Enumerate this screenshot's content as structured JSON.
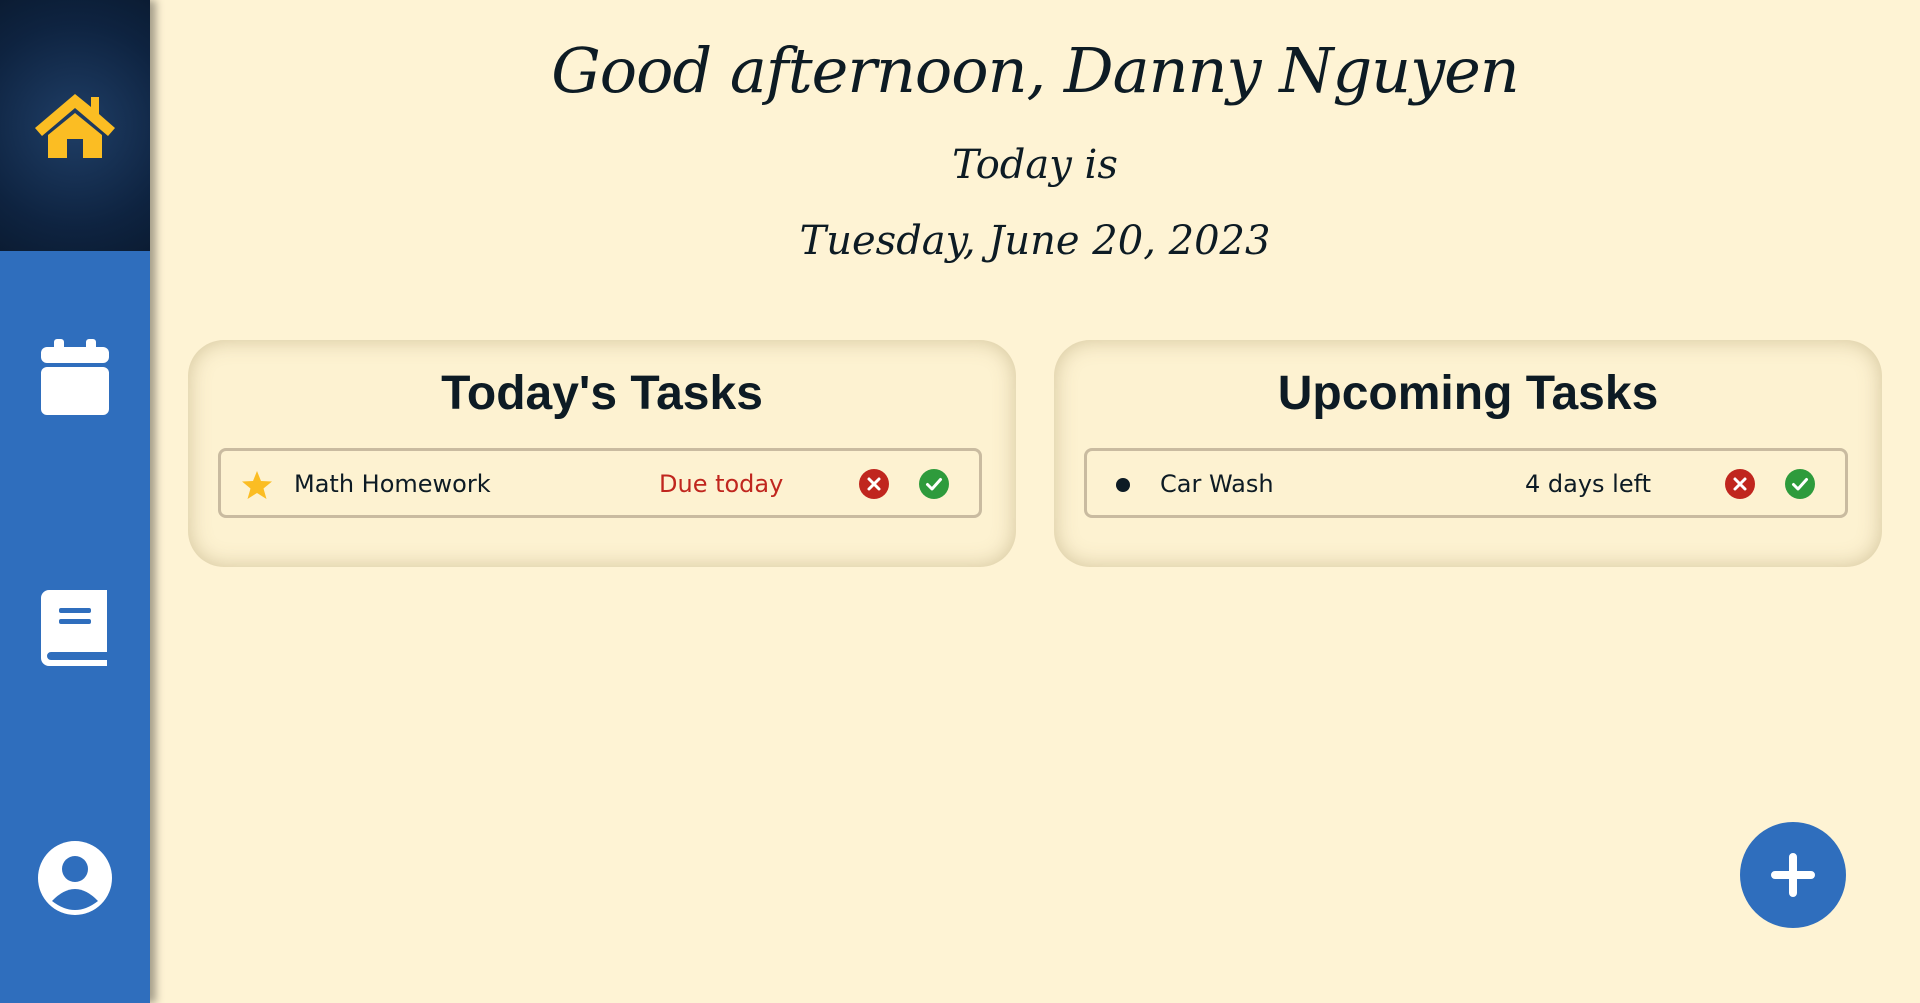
{
  "header": {
    "greeting": "Good afternoon, Danny Nguyen",
    "today_is": "Today is",
    "date": "Tuesday, June 20, 2023"
  },
  "sidebar": {
    "items": [
      {
        "icon": "home-icon",
        "active": true
      },
      {
        "icon": "calendar-icon",
        "active": false
      },
      {
        "icon": "book-icon",
        "active": false
      },
      {
        "icon": "user-icon",
        "active": false
      }
    ]
  },
  "today_panel": {
    "title": "Today's Tasks",
    "tasks": [
      {
        "name": "Math Homework",
        "due": "Due today",
        "marker": "star-icon"
      }
    ]
  },
  "upcoming_panel": {
    "title": "Upcoming Tasks",
    "tasks": [
      {
        "name": "Car Wash",
        "due": "4 days left",
        "marker": "bullet-icon"
      }
    ]
  },
  "colors": {
    "background": "#fef3d4",
    "sidebar": "#2f6ebd",
    "sidebar_active": "#0e2340",
    "home_icon": "#fbbd23",
    "due_today": "#c0261e",
    "delete": "#c0261e",
    "complete": "#2e9b3c"
  }
}
